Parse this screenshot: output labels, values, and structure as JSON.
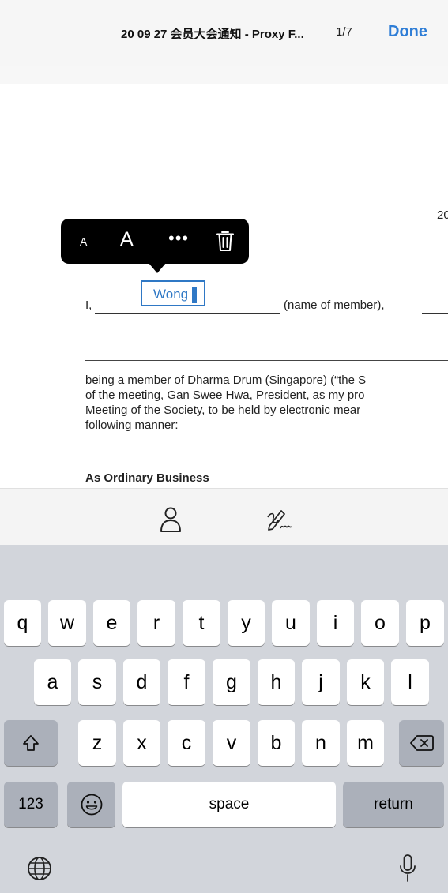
{
  "header": {
    "title": "20 09 27 会员大会通知 - Proxy F...",
    "page_indicator": "1/7",
    "done_label": "Done"
  },
  "document": {
    "page_marker": "20",
    "line_prefix": "I,",
    "name_label": "(name of member),",
    "paragraph_lines": [
      "being a member of Dharma Drum (Singapore) (“the S",
      "of the meeting, Gan Swee Hwa, President, as my pro",
      "Meeting of the Society, to be held by electronic mear",
      "following manner:"
    ],
    "section_heading": "As Ordinary Business"
  },
  "text_field": {
    "value": "Wong"
  },
  "popover": {
    "small_font_label": "A",
    "large_font_label": "A",
    "more_label": "•••",
    "icons": [
      "trash-icon"
    ]
  },
  "accessory_bar": {
    "icons": [
      "person-icon",
      "signature-icon"
    ]
  },
  "keyboard": {
    "row1": [
      "q",
      "w",
      "e",
      "r",
      "t",
      "y",
      "u",
      "i",
      "o",
      "p"
    ],
    "row2": [
      "a",
      "s",
      "d",
      "f",
      "g",
      "h",
      "j",
      "k",
      "l"
    ],
    "row3": [
      "z",
      "x",
      "c",
      "v",
      "b",
      "n",
      "m"
    ],
    "numbers_label": "123",
    "space_label": "space",
    "return_label": "return",
    "icons": [
      "shift-icon",
      "delete-icon",
      "emoji-icon",
      "globe-icon",
      "microphone-icon"
    ]
  },
  "colors": {
    "accent": "#2e7dd6",
    "field_border": "#2f78c5",
    "keyboard_bg": "#d2d5db",
    "key_dark": "#abb0ba"
  }
}
